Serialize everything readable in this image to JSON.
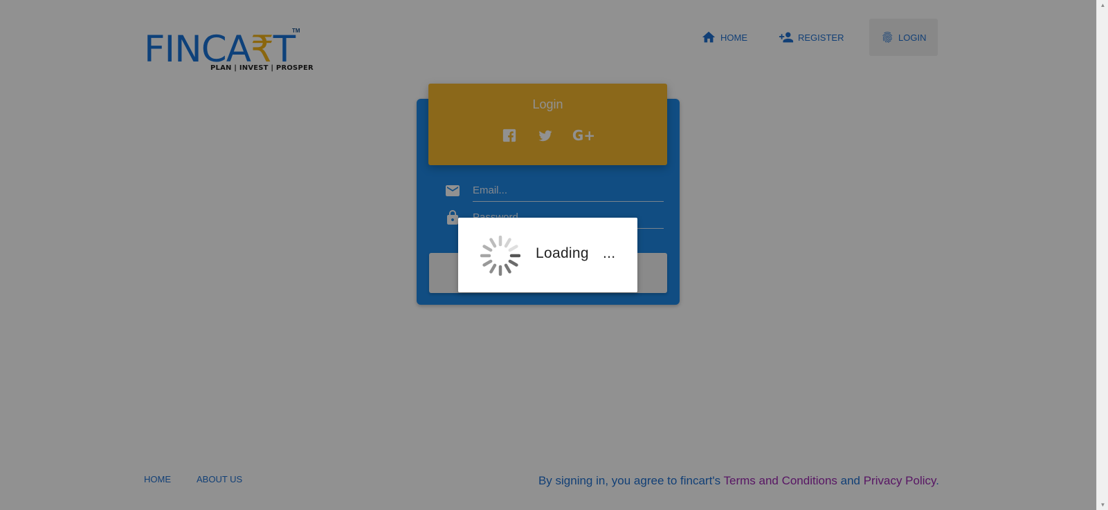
{
  "brand": {
    "name_start": "FINCA",
    "name_rupee": "₹",
    "name_end": "T",
    "trademark": "TM",
    "tagline": "PLAN | INVEST | PROSPER",
    "primary_color": "#1e88e5",
    "accent_color": "#f5b82e"
  },
  "nav": {
    "items": [
      {
        "label": "HOME",
        "icon": "home-icon"
      },
      {
        "label": "REGISTER",
        "icon": "person-add-icon"
      },
      {
        "label": "LOGIN",
        "icon": "fingerprint-icon",
        "active": true
      }
    ]
  },
  "login_card": {
    "title": "Login",
    "social": [
      {
        "icon": "facebook-icon"
      },
      {
        "icon": "twitter-icon"
      },
      {
        "icon": "google-plus-icon",
        "text": "G+"
      }
    ],
    "email_placeholder": "Email...",
    "password_placeholder": "Password"
  },
  "footer": {
    "links": [
      "HOME",
      "ABOUT US"
    ],
    "note_prefix": "By signing in, you agree to fincart's ",
    "terms_label": "Terms and Conditions",
    "note_middle": " and ",
    "privacy_label": "Privacy Policy",
    "note_suffix": "."
  },
  "loading": {
    "text": "Loading",
    "dots": "..."
  }
}
